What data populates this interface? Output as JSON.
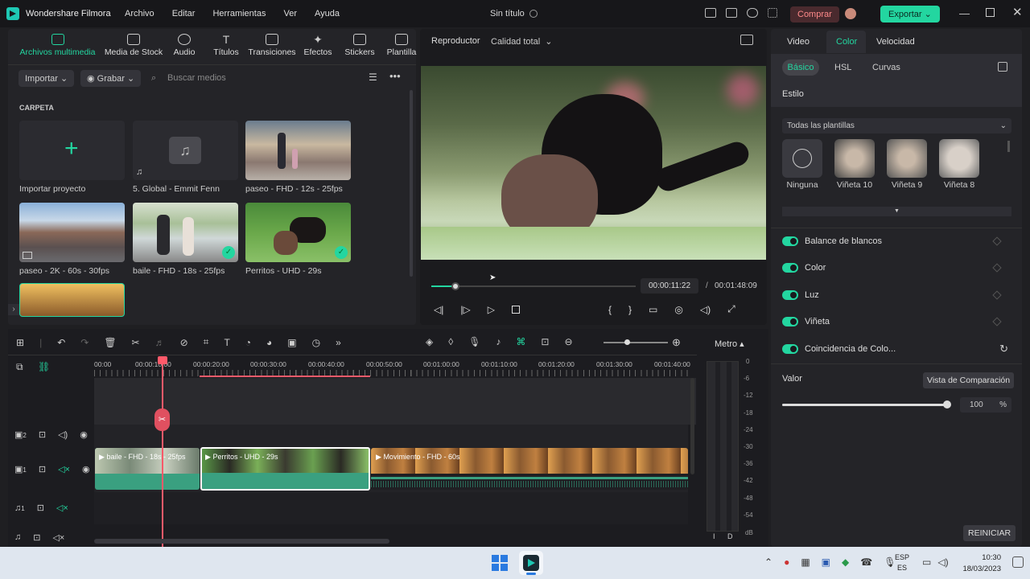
{
  "app": {
    "name": "Wondershare Filmora",
    "doc_title": "Sin título"
  },
  "menu": [
    "Archivo",
    "Editar",
    "Herramientas",
    "Ver",
    "Ayuda"
  ],
  "titlebar": {
    "buy_label": "Comprar",
    "export_label": "Exportar"
  },
  "media_tabs": [
    "Archivos multimedia",
    "Media de Stock",
    "Audio",
    "Títulos",
    "Transiciones",
    "Efectos",
    "Stickers",
    "Plantilla"
  ],
  "media_toolbar": {
    "import_label": "Importar",
    "record_label": "Grabar",
    "search_placeholder": "Buscar medios"
  },
  "media": {
    "folder_label": "CARPETA",
    "items": [
      "Importar proyecto",
      "5. Global - Emmit Fenn",
      "paseo - FHD - 12s - 25fps",
      "paseo - 2K - 60s - 30fps",
      "baile - FHD - 18s - 25fps",
      "Perritos - UHD - 29s"
    ]
  },
  "player": {
    "label": "Reproductor",
    "quality": "Calidad total",
    "current_time": "00:00:11:22",
    "separator": "/",
    "total_time": "00:01:48:09",
    "progress": 0.12
  },
  "right": {
    "tabs": [
      "Video",
      "Color",
      "Velocidad"
    ],
    "subtabs": [
      "Básico",
      "HSL",
      "Curvas"
    ],
    "style_label": "Estilo",
    "template_select": "Todas las plantillas",
    "presets": [
      "Ninguna",
      "Viñeta 10",
      "Viñeta 9",
      "Viñeta 8"
    ],
    "props": [
      "Balance de blancos",
      "Color",
      "Luz",
      "Viñeta",
      "Coincidencia de Colo..."
    ],
    "value_label": "Valor",
    "compare_label": "Vista de Comparación",
    "value": "100",
    "unit": "%",
    "value_level": 1.0,
    "reset_label": "REINICIAR"
  },
  "timeline": {
    "meter_label": "Metro",
    "ruler": [
      "00:00",
      "00:00:10:00",
      "00:00:20:00",
      "00:00:30:00",
      "00:00:40:00",
      "00:00:50:00",
      "00:01:00:00",
      "00:01:10:00",
      "00:01:20:00",
      "00:01:30:00",
      "00:01:40:00"
    ],
    "tracks": [
      "2",
      "1",
      "1"
    ],
    "clips": [
      "baile - FHD - 18s - 25fps",
      "Perritos - UHD - 29s",
      "Movimiento - FHD - 60s"
    ],
    "vu_scale": [
      "0",
      "-6",
      "-12",
      "-18",
      "-24",
      "-30",
      "-36",
      "-42",
      "-48",
      "-54",
      "dB"
    ],
    "vu_channels": [
      "I",
      "D"
    ]
  },
  "taskbar": {
    "lang1": "ESP",
    "lang2": "ES",
    "time": "10:30",
    "date": "18/03/2023"
  },
  "colors": {
    "accent": "#23d6a0",
    "playhead": "#ff5a6a"
  }
}
